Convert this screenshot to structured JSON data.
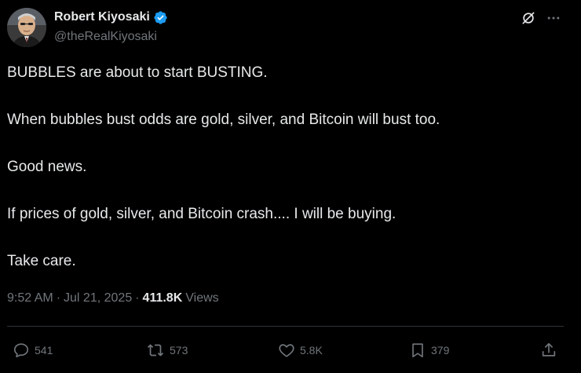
{
  "author": {
    "display_name": "Robert Kiyosaki",
    "handle": "@theRealKiyosaki",
    "verified_color": "#1d9bf0"
  },
  "tweet": {
    "paragraphs": [
      "BUBBLES are about to start BUSTING.",
      "When bubbles bust odds are gold, silver, and Bitcoin will bust too.",
      "Good news.",
      "If prices of gold, silver, and Bitcoin crash.... I will be buying.",
      "Take care."
    ]
  },
  "meta": {
    "time": "9:52 AM",
    "separator1": "·",
    "date": "Jul 21, 2025",
    "separator2": "·",
    "views_count": "411.8K",
    "views_label": "Views"
  },
  "actions": {
    "replies": "541",
    "reposts": "573",
    "likes": "5.8K",
    "bookmarks": "379"
  },
  "icons": [
    "grok-icon",
    "more-icon",
    "reply-icon",
    "repost-icon",
    "like-icon",
    "bookmark-icon",
    "share-icon",
    "verified-icon"
  ],
  "colors": {
    "background": "#000000",
    "text_primary": "#e7e9ea",
    "text_secondary": "#71767b",
    "divider": "#2f3336",
    "verified": "#1d9bf0"
  }
}
